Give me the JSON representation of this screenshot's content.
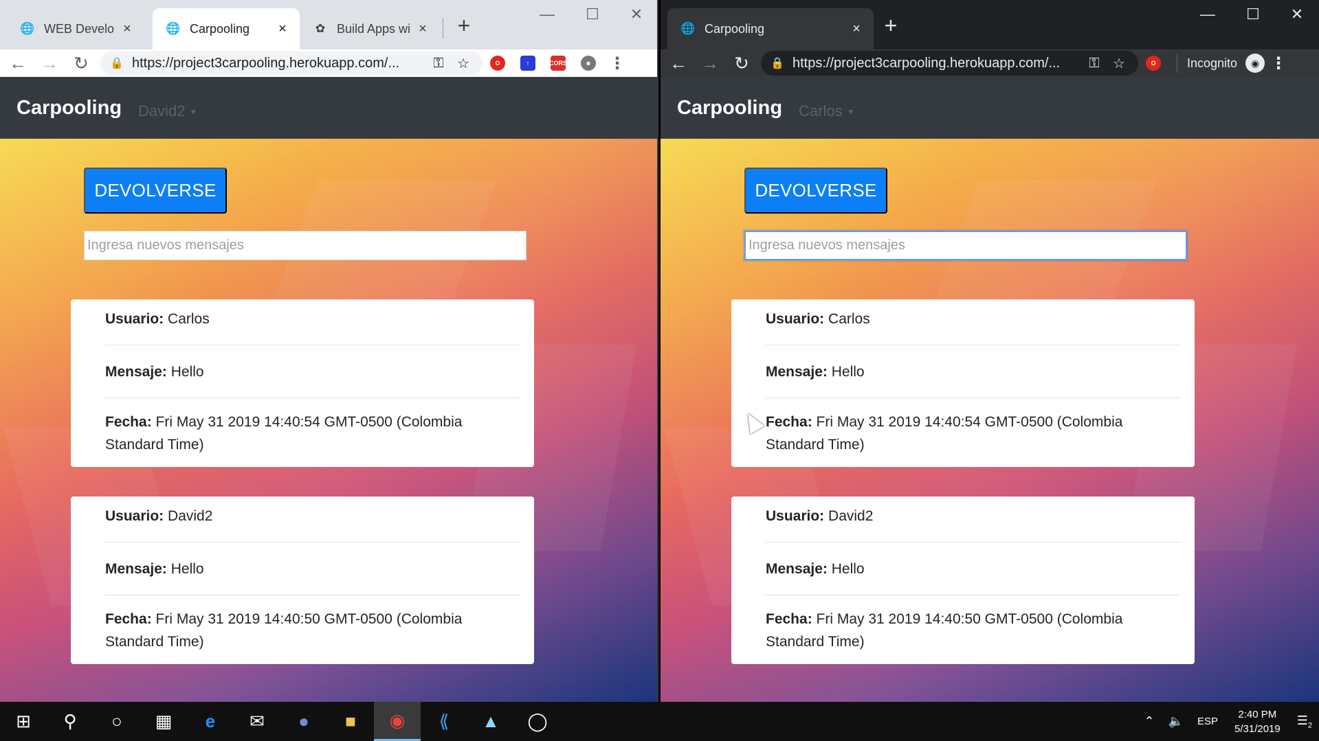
{
  "left_window": {
    "tabs": [
      {
        "title": "WEB Developm",
        "favicon": "globe-icon"
      },
      {
        "title": "Carpooling",
        "favicon": "globe-icon",
        "active": true
      },
      {
        "title": "Build Apps with",
        "favicon": "feather-icon"
      }
    ],
    "url": "https://project3carpooling.herokuapp.com/...",
    "extensions": [
      "opera-ext",
      "blue-ext",
      "CORS"
    ],
    "page": {
      "brand": "Carpooling",
      "user": "David2",
      "back_button": "DEVOLVERSE",
      "input_placeholder": "Ingresa nuevos mensajes",
      "messages": [
        {
          "usuario_label": "Usuario:",
          "usuario": "Carlos",
          "mensaje_label": "Mensaje:",
          "mensaje": "Hello",
          "fecha_label": "Fecha:",
          "fecha": "Fri May 31 2019 14:40:54 GMT-0500 (Colombia Standard Time)"
        },
        {
          "usuario_label": "Usuario:",
          "usuario": "David2",
          "mensaje_label": "Mensaje:",
          "mensaje": "Hello",
          "fecha_label": "Fecha:",
          "fecha": "Fri May 31 2019 14:40:50 GMT-0500 (Colombia Standard Time)"
        }
      ]
    }
  },
  "right_window": {
    "tabs": [
      {
        "title": "Carpooling",
        "favicon": "globe-icon",
        "active": true
      }
    ],
    "url": "https://project3carpooling.herokuapp.com/...",
    "incognito_label": "Incognito",
    "page": {
      "brand": "Carpooling",
      "user": "Carlos",
      "back_button": "DEVOLVERSE",
      "input_placeholder": "Ingresa nuevos mensajes",
      "messages": [
        {
          "usuario_label": "Usuario:",
          "usuario": "Carlos",
          "mensaje_label": "Mensaje:",
          "mensaje": "Hello",
          "fecha_label": "Fecha:",
          "fecha": "Fri May 31 2019 14:40:54 GMT-0500 (Colombia Standard Time)"
        },
        {
          "usuario_label": "Usuario:",
          "usuario": "David2",
          "mensaje_label": "Mensaje:",
          "mensaje": "Hello",
          "fecha_label": "Fecha:",
          "fecha": "Fri May 31 2019 14:40:50 GMT-0500 (Colombia Standard Time)"
        }
      ]
    }
  },
  "taskbar": {
    "icons": [
      "windows-start-icon",
      "search-icon",
      "cortana-icon",
      "task-view-icon",
      "edge-icon",
      "mail-icon",
      "discord-icon",
      "file-explorer-icon",
      "chrome-icon",
      "vscode-icon",
      "app-icon",
      "obs-icon"
    ],
    "language": "ESP",
    "time": "2:40 PM",
    "date": "5/31/2019",
    "notification_count": "2"
  },
  "colors": {
    "navbar": "#343a40",
    "primary_button": "#0d7ff6",
    "card": "#ffffff"
  }
}
